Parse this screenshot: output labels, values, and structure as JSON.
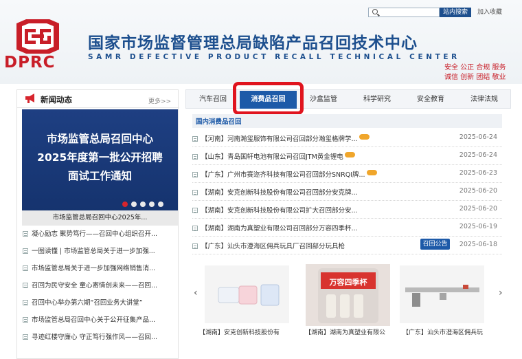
{
  "header": {
    "search_placeholder": "",
    "search_button": "站内搜索",
    "favorite_link": "加入收藏",
    "logo_text": "DPRC",
    "title": "国家市场监督管理总局缺陷产品召回技术中心",
    "subtitle": "SAMR DEFECTIVE PRODUCT RECALL TECHNICAL CENTER",
    "values_line1": "安全 公正 合规 服务",
    "values_line2": "诚信 创新 团结 敬业"
  },
  "news": {
    "title": "新闻动态",
    "more": "更多>>",
    "banner_lines": [
      "市场监管总局召回中心",
      "2025年度第一批公开招聘",
      "面试工作通知"
    ],
    "banner_caption": "市场监管总局召回中心2025年...",
    "items": [
      "凝心励志 聚势笃行——召回中心组织召开...",
      "一图读懂 | 市场监管总局关于进一步加强...",
      "市场监管总局关于进一步加强网络销售消...",
      "召回为民守安全 童心寄情创未来——召回...",
      "召回中心举办第六期“召回业务大讲堂”",
      "市场监管总局召回中心关于公开征集产品...",
      "寻迹红楼守廉心 守正笃行强作风——召回..."
    ]
  },
  "tabs": [
    "汽车召回",
    "消费品召回",
    "沙盒监管",
    "科学研究",
    "安全教育",
    "法律法规"
  ],
  "section_label": "国内消费品召回",
  "recalls": [
    {
      "text": "【河南】河南瀚玺服饰有限公司召回部分瀚玺格牌学...",
      "date": "2025-06-24"
    },
    {
      "text": "【山东】青岛国轩电池有限公司召回JTM黄金锂电",
      "date": "2025-06-24"
    },
    {
      "text": "【广东】广州市赛迩齐科技有限公司召回部分SNRQI牌...",
      "date": "2025-06-23"
    },
    {
      "text": "【湖南】安克创新科技股份有限公司召回部分安克牌...",
      "date": "2025-06-20"
    },
    {
      "text": "【湖南】安克创新科技股份有限公司扩大召回部分安...",
      "date": "2025-06-20"
    },
    {
      "text": "【湖南】湖南为真塑业有限公司召回部分万容四季杯...",
      "date": "2025-06-19"
    },
    {
      "text": "【广东】汕头市澄海区佣兵玩具厂召回部分玩具枪",
      "date": "2025-06-18",
      "badge": "召回公告"
    }
  ],
  "carousel": {
    "captions": [
      "【湖南】安克创新科技股份有",
      "【湖南】湖南为真塑业有限公",
      "【广东】汕头市澄海区佣兵玩"
    ],
    "product_label": "万容四季杯"
  },
  "colors": {
    "brand_blue": "#1d4f8e",
    "accent_red": "#c81e28",
    "tab_active": "#1d5aa8",
    "highlight": "#e0141e"
  }
}
